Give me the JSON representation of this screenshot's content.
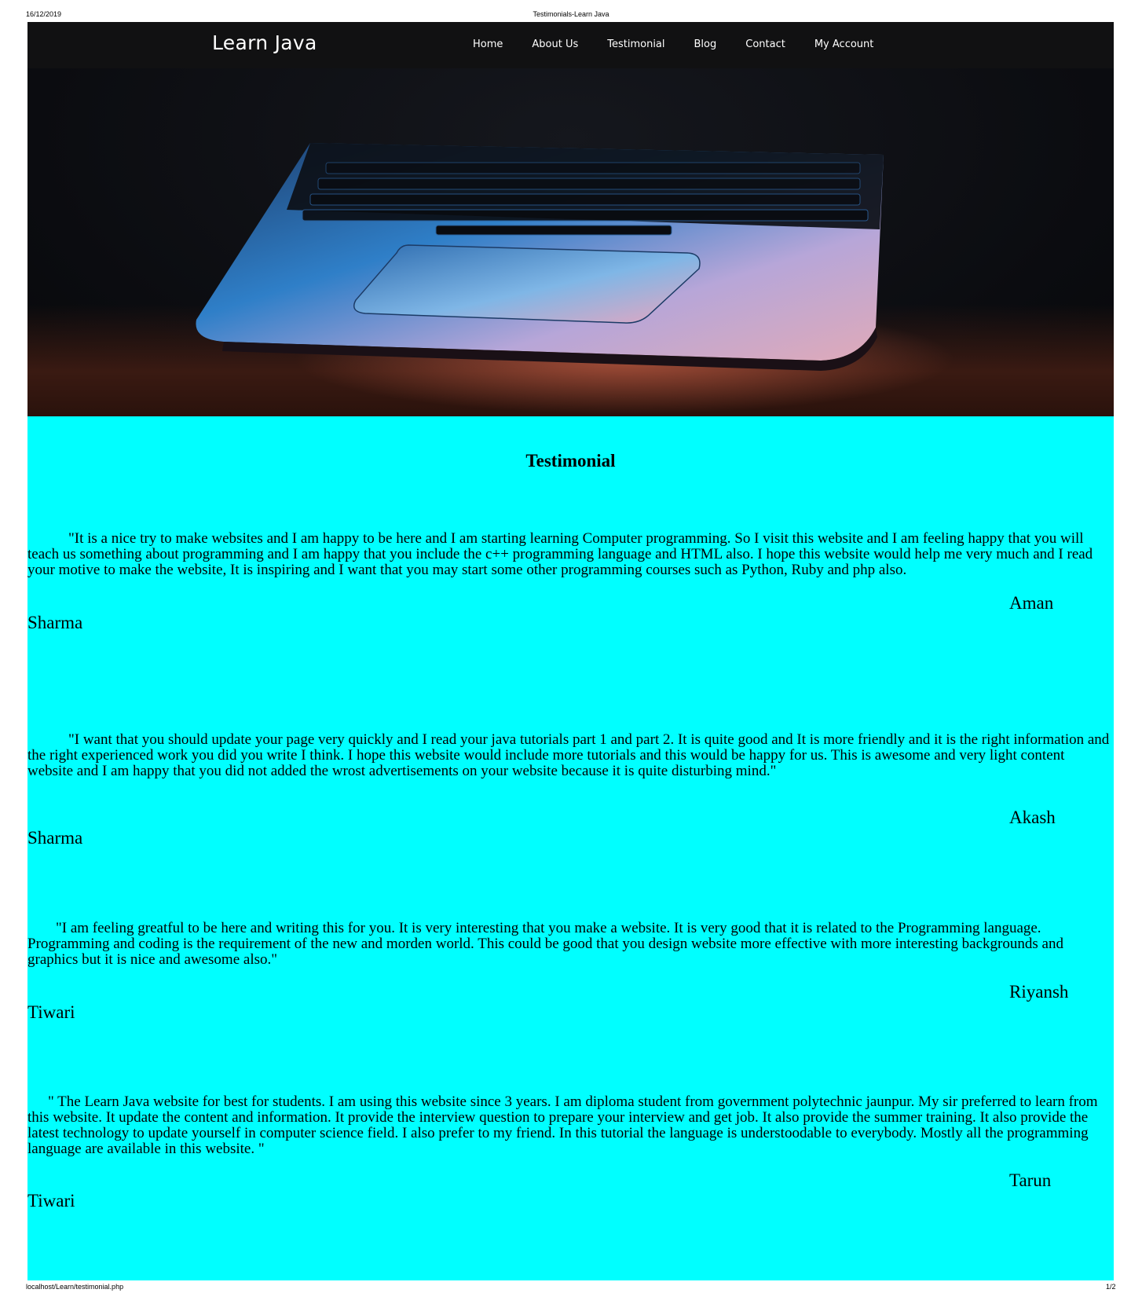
{
  "print_header": {
    "date": "16/12/2019",
    "title": "Testimonials-Learn Java"
  },
  "print_footer": {
    "url": "localhost/Learn/testimonial.php",
    "page": "1/2"
  },
  "navbar": {
    "brand": "Learn Java",
    "links": [
      "Home",
      "About Us",
      "Testimonial",
      "Blog",
      "Contact",
      "My Account"
    ]
  },
  "hero": {
    "image": "laptop-keyboard-photo"
  },
  "main": {
    "title": "Testimonial",
    "testimonials": [
      {
        "quote": "\"It is a nice try to make websites and I am happy to be here and I am starting learning Computer programming. So I visit this website and I am feeling happy        that you will teach us something about programming and I am happy that you include the c++ programming language and HTML also. I hope this website        would help me very much and I read your motive to make the website, It is inspiring and I want that you may start some other programming courses such as Python, Ruby and php also.",
        "author_first": "Aman",
        "author_last": "Sharma"
      },
      {
        "quote": "\"I want that you should update your page very quickly and I read your java tutorials part 1 and part 2. It is quite good and It is more friendly and it is the right            information and the right experienced work you did you write I think. I hope this website would include more tutorials and this would be happy for us. This is          awesome and very light content website and I am happy that you did not added the wrost advertisements on your website because it is quite disturbing mind.\"",
        "author_first": "Akash",
        "author_last": "Sharma"
      },
      {
        "quote": "\"I am feeling greatful to be here and writing this for you. It is very interesting that you make a website. It is very good that it is related to the Programming       language. Programming and coding is the requirement of the new and morden world. This could be good that you design website more effective with more interesting backgrounds and graphics but it is nice and awesome also.\"",
        "author_first": "Riyansh",
        "author_last": "Tiwari"
      },
      {
        "quote": "\" The Learn Java website for best for students. I am using this website since 3 years. I am diploma student from government polytechnic jaunpur. My sir          preferred to learn from this website. It update the content and information. It provide the interview question to prepare your interview and get job. It also                 provide the summer training. It also provide the latest technology to update yourself in computer science field. I also prefer to my friend. In this tutorial the language is understoodable to everybody. Mostly all the programming language are available in this website. \"",
        "author_first": "Tarun",
        "author_last": "Tiwari"
      }
    ]
  }
}
